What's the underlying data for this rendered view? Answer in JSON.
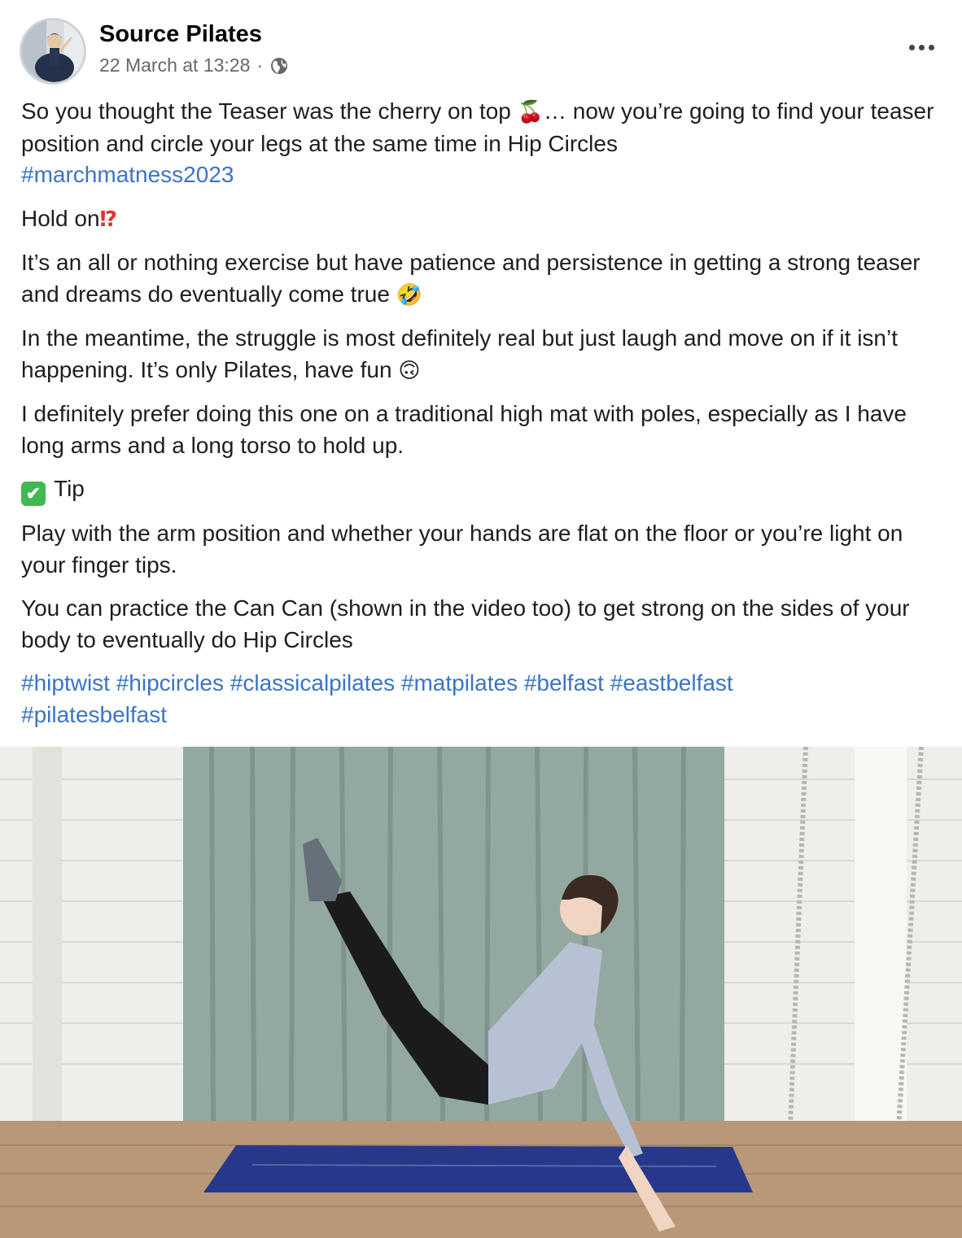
{
  "post": {
    "author": "Source Pilates",
    "timestamp": "22 March at 13:28",
    "separator": "·",
    "audience_icon": "globe-icon",
    "more_icon": "more-options-icon"
  },
  "body": {
    "p1_text": "So you thought the Teaser was the cherry on top",
    "p1_emoji": "🍒",
    "p1_text2": "… now you’re going to find your teaser position and circle your legs at the same time in Hip Circles",
    "p1_hashtag": "#marchmatness2023",
    "p2_text": "Hold on",
    "p2_emoji": "⁉",
    "p3_text": "It’s an all or nothing exercise but have patience and persistence in getting a strong teaser and dreams do eventually come true",
    "p3_emoji": "🤣",
    "p4_text": "In the meantime, the struggle is most definitely real but just laugh and move on if it isn’t happening. It’s only Pilates, have fun",
    "p4_emoji": "🙃",
    "p5_text": "I definitely prefer doing this one on a traditional high mat with poles, especially as I have long arms and a long torso to hold up.",
    "p6_emoji": "✔",
    "p6_text": "Tip",
    "p7_text": "Play with the arm position and whether your hands are flat on the floor or you’re light on your finger tips.",
    "p8_text": "You can practice the Can Can (shown in the video too) to get strong on the sides of your body to eventually do Hip Circles",
    "hashtags": [
      "#hiptwist",
      "#hipcircles",
      "#classicalpilates",
      "#matpilates",
      "#belfast",
      "#eastbelfast",
      "#pilatesbelfast"
    ]
  },
  "colors": {
    "hashtag": "#3b74c6",
    "meta_text": "#65676b",
    "curtain": "#93a8a0",
    "mat": "#27388a",
    "floor": "#b89878"
  }
}
